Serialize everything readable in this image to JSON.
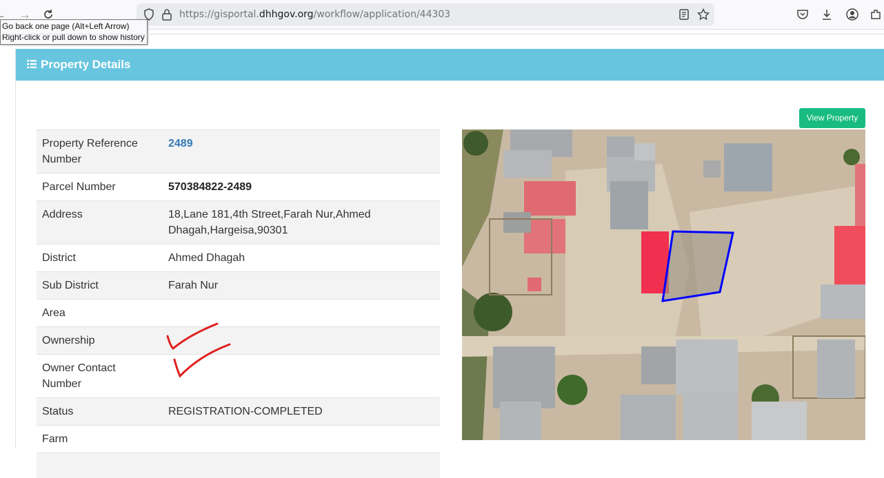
{
  "browser": {
    "url_prefix": "https://gisportal.",
    "url_domain": "dhhgov.org",
    "url_path": "/workflow/application/44303",
    "tooltip_line1": "Go back one page (Alt+Left Arrow)",
    "tooltip_line2": "Right-click or pull down to show history",
    "icons": [
      "back-icon",
      "forward-icon",
      "reload-icon",
      "shield-icon",
      "lock-icon",
      "reader-view-icon",
      "bookmark-star-icon",
      "pocket-icon",
      "download-icon",
      "account-icon",
      "extensions-icon"
    ]
  },
  "panel": {
    "title": "Property Details",
    "view_button": "View Property"
  },
  "details": [
    {
      "label": "Property Reference Number",
      "value": "2489",
      "style": "link"
    },
    {
      "label": "Parcel Number",
      "value": "570384822-2489",
      "style": "bold"
    },
    {
      "label": "Address",
      "value": "18,Lane 181,4th Street,Farah Nur,Ahmed Dhagah,Hargeisa,90301",
      "style": "plain"
    },
    {
      "label": "District",
      "value": "Ahmed Dhagah",
      "style": "plain"
    },
    {
      "label": "Sub District",
      "value": "Farah Nur",
      "style": "plain"
    },
    {
      "label": "Area",
      "value": "",
      "style": "plain"
    },
    {
      "label": "Ownership",
      "value": "",
      "style": "plain"
    },
    {
      "label": "Owner Contact Number",
      "value": "",
      "style": "plain"
    },
    {
      "label": "Status",
      "value": "REGISTRATION-COMPLETED",
      "style": "plain"
    },
    {
      "label": "Farm",
      "value": "",
      "style": "plain"
    }
  ],
  "colors": {
    "panel_header": "#67c5e0",
    "view_button": "#18bc82",
    "link": "#337ab7",
    "parcel_outline": "#0000ff",
    "check_marks": "#e02020"
  }
}
